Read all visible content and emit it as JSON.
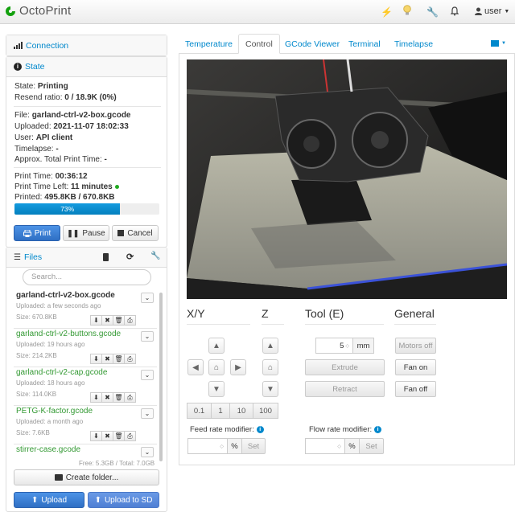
{
  "brand": {
    "name": "OctoPrint"
  },
  "nav": {
    "user": "user"
  },
  "connection": {
    "title": "Connection"
  },
  "state": {
    "title": "State",
    "state_label": "State:",
    "state_value": "Printing",
    "resend_label": "Resend ratio:",
    "resend_value": "0 / 18.9K (0%)",
    "file_label": "File:",
    "file_value": "garland-ctrl-v2-box.gcode",
    "uploaded_label": "Uploaded:",
    "uploaded_value": "2021-11-07 18:02:33",
    "user_label": "User:",
    "user_value": "API client",
    "timelapse_label": "Timelapse:",
    "timelapse_value": "-",
    "approx_label": "Approx. Total Print Time:",
    "approx_value": "-",
    "printtime_label": "Print Time:",
    "printtime_value": "00:36:12",
    "timeleft_label": "Print Time Left:",
    "timeleft_value": "11 minutes",
    "printed_label": "Printed:",
    "printed_value": "495.8KB / 670.8KB",
    "progress_text": "73%",
    "progress": 0.73,
    "print_btn": "Print",
    "pause_btn": "Pause",
    "cancel_btn": "Cancel"
  },
  "files": {
    "title": "Files",
    "search_placeholder": "Search...",
    "items": [
      {
        "name": "garland-ctrl-v2-box.gcode",
        "uploaded": "Uploaded: a few seconds ago",
        "size": "Size: 670.8KB",
        "active": true
      },
      {
        "name": "garland-ctrl-v2-buttons.gcode",
        "uploaded": "Uploaded: 19 hours ago",
        "size": "Size: 214.2KB"
      },
      {
        "name": "garland-ctrl-v2-cap.gcode",
        "uploaded": "Uploaded: 18 hours ago",
        "size": "Size: 114.0KB"
      },
      {
        "name": "PETG-K-factor.gcode",
        "uploaded": "Uploaded: a month ago",
        "size": "Size: 7.6KB"
      },
      {
        "name": "stirrer-case.gcode",
        "uploaded": "",
        "size": ""
      }
    ],
    "free": "Free: 5.3GB / Total: 7.0GB",
    "create_folder": "Create folder...",
    "upload": "Upload",
    "upload_sd": "Upload to SD"
  },
  "tabs": [
    "Temperature",
    "Control",
    "GCode Viewer",
    "Terminal",
    "Timelapse"
  ],
  "control": {
    "xy": "X/Y",
    "z": "Z",
    "tool": "Tool (E)",
    "general": "General",
    "steps": [
      "0.1",
      "1",
      "10",
      "100"
    ],
    "extrude_amount": "5",
    "extrude_unit": "mm",
    "extrude": "Extrude",
    "retract": "Retract",
    "motors_off": "Motors off",
    "fan_on": "Fan on",
    "fan_off": "Fan off",
    "feed_label": "Feed rate modifier:",
    "flow_label": "Flow rate modifier:",
    "percent": "%",
    "set": "Set"
  },
  "colors": {
    "accent": "#0088cc",
    "primary": "#2f6fc4",
    "file_green": "#339933",
    "progress": "#149bdf"
  }
}
